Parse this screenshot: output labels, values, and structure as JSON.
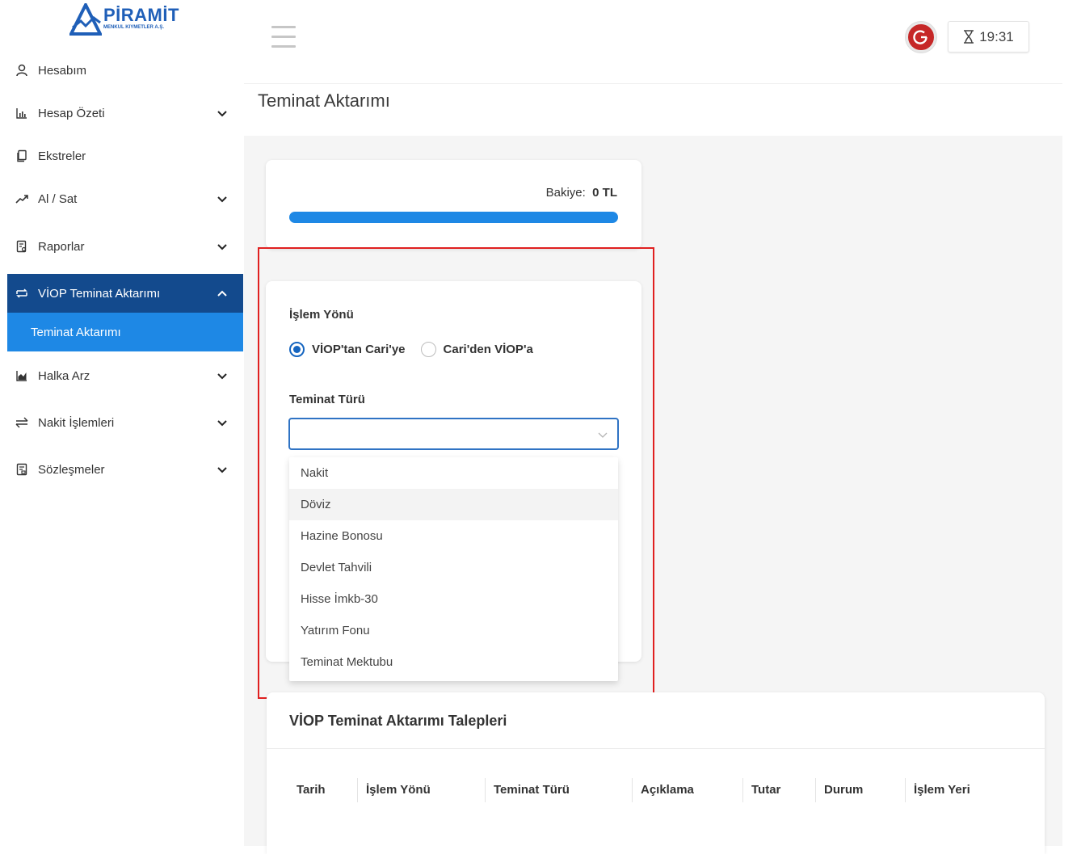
{
  "brand": {
    "name": "PİRAMİT",
    "subtitle": "MENKUL KIYMETLER A.Ş.",
    "color": "#1f5fb8"
  },
  "sidebar": {
    "items": [
      {
        "label": "Hesabım",
        "icon": "user-icon",
        "has_chevron": false
      },
      {
        "label": "Hesap Özeti",
        "icon": "bar-chart-icon",
        "has_chevron": true
      },
      {
        "label": "Ekstreler",
        "icon": "document-copy-icon",
        "has_chevron": false
      },
      {
        "label": "Al / Sat",
        "icon": "trend-line-icon",
        "has_chevron": true
      },
      {
        "label": "Raporlar",
        "icon": "report-icon",
        "has_chevron": true
      },
      {
        "label": "VİOP Teminat Aktarımı",
        "icon": "transfer-icon",
        "has_chevron": true,
        "active": true
      },
      {
        "label": "Halka Arz",
        "icon": "area-chart-icon",
        "has_chevron": true
      },
      {
        "label": "Nakit İşlemleri",
        "icon": "exchange-icon",
        "has_chevron": true
      },
      {
        "label": "Sözleşmeler",
        "icon": "contract-icon",
        "has_chevron": true
      }
    ],
    "sub_item": "Teminat Aktarımı",
    "active_color": "#134a8d",
    "sub_active_color": "#1e88e5"
  },
  "header": {
    "menu_icon": "hamburger-icon",
    "logout_icon": "power-icon",
    "timer_icon": "hourglass-icon",
    "session_time": "19:31"
  },
  "page": {
    "title": "Teminat Aktarımı"
  },
  "balance": {
    "label": "Bakiye:",
    "value": "0 TL",
    "progress_fraction": 1.0
  },
  "form": {
    "direction_label": "İşlem Yönü",
    "direction_options": [
      {
        "label": "VİOP'tan Cari'ye",
        "checked": true
      },
      {
        "label": "Cari'den VİOP'a",
        "checked": false
      }
    ],
    "collateral_label": "Teminat Türü",
    "collateral_value": "",
    "collateral_options": [
      "Nakit",
      "Döviz",
      "Hazine Bonosu",
      "Devlet Tahvili",
      "Hisse İmkb-30",
      "Yatırım Fonu",
      "Teminat Mektubu"
    ],
    "hovered_option": "Döviz"
  },
  "requests": {
    "title": "VİOP Teminat Aktarımı Talepleri",
    "columns": [
      "Tarih",
      "İşlem Yönü",
      "Teminat Türü",
      "Açıklama",
      "Tutar",
      "Durum",
      "İşlem Yeri"
    ]
  },
  "colors": {
    "highlight_border": "#e02020",
    "primary": "#1e88e5",
    "logout": "#c62828"
  }
}
